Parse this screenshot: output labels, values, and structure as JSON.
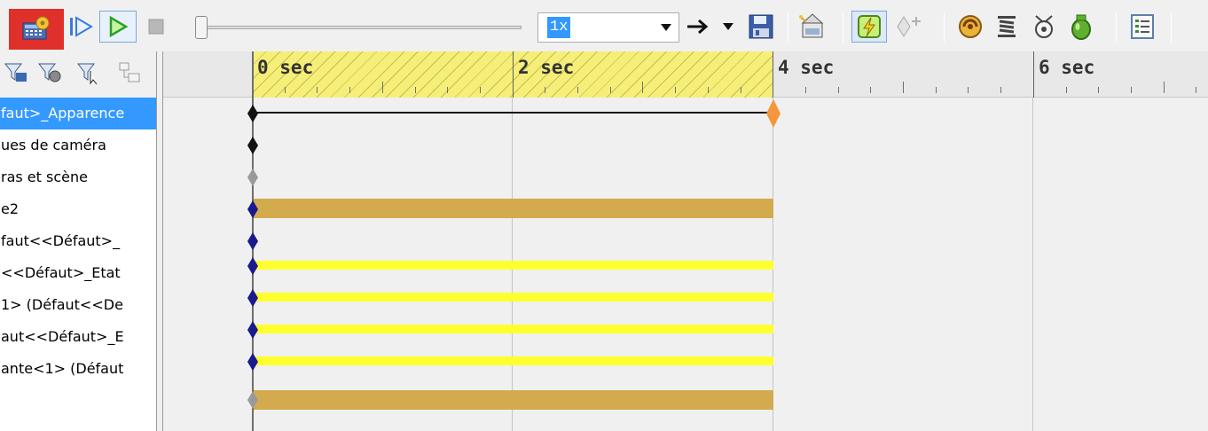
{
  "toolbar": {
    "speed": {
      "value": "1x"
    }
  },
  "tree": {
    "rows": [
      {
        "label": "faut>_Apparence",
        "selected": true
      },
      {
        "label": "ues de caméra"
      },
      {
        "label": "ras et scène"
      },
      {
        "label": "e2"
      },
      {
        "label": "faut<<Défaut>_"
      },
      {
        "label": "<<Défaut>_Etat"
      },
      {
        "label": "1> (Défaut<<De"
      },
      {
        "label": "aut<<Défaut>_E"
      },
      {
        "label": "ante<1> (Défaut"
      }
    ]
  },
  "timeline": {
    "ticks": [
      {
        "label": "0 sec",
        "seconds": 0
      },
      {
        "label": "2 sec",
        "seconds": 2
      },
      {
        "label": "4 sec",
        "seconds": 4
      },
      {
        "label": "6 sec",
        "seconds": 6
      }
    ],
    "animation_end_seconds": 4,
    "playhead_seconds": 0
  },
  "colors": {
    "selection": "#3399ff",
    "bar_tan": "#d4aa4e",
    "bar_yellow": "#ffff2e",
    "keyframe_blue": "#1a1a8c",
    "keyframe_black": "#111111",
    "keyframe_gray": "#9a9a9a",
    "keyframe_orange": "#f5963c",
    "highlight": "#e0302c"
  }
}
